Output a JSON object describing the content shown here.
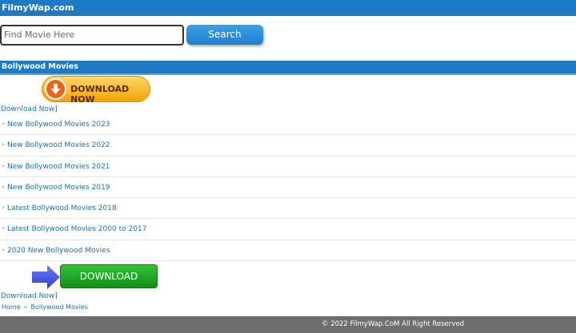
{
  "header": {
    "site_name": "FilmyWap.com"
  },
  "search": {
    "placeholder": "Find Movie Here",
    "button_label": "Search"
  },
  "section": {
    "title": "Bollywood Movies"
  },
  "download_now_badge": {
    "label": "DOWNLOAD NOW"
  },
  "download_now_text": "Download Now]",
  "list_items": [
    "New Bollywood Movies 2023",
    "New Bollywood Movies 2022",
    "New Bollywood Movies 2021",
    "New Bollywood Movies 2019",
    "Latest Bollywood Movies 2018",
    "Latest Bollywood Movies 2000 to 2017",
    "2020 New Bollywood Movies"
  ],
  "list_bullet": "»",
  "download_button": {
    "label": "DOWNLOAD"
  },
  "breadcrumb": {
    "home": "Home",
    "separator": "»",
    "current": "Bollywood Movies"
  },
  "footer": {
    "text": "© 2022 FilmyWap.CoM All Right Reserved"
  },
  "colors": {
    "header_bg": "#1e7ac4",
    "link": "#1e6fb0",
    "footer_bg": "#6e6e6e",
    "download_green": "#1ea823",
    "badge_orange": "#f4a200"
  }
}
